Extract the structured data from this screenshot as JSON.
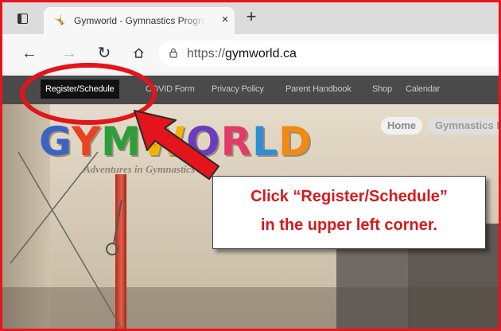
{
  "browser": {
    "tab": {
      "title": "Gymworld - Gymnastics Program",
      "close_glyph": "×"
    },
    "new_tab_glyph": "+",
    "nav": {
      "back_glyph": "←",
      "forward_glyph": "→",
      "reload_glyph": "↻"
    },
    "url": {
      "prefix": "https://",
      "host": "gymworld.ca"
    }
  },
  "site": {
    "nav_items": [
      {
        "label": "Register/Schedule",
        "active": true
      },
      {
        "label": "COVID Form"
      },
      {
        "label": "Privacy Policy"
      },
      {
        "label": "Parent Handbook"
      },
      {
        "label": "Shop"
      },
      {
        "label": "Calendar"
      }
    ],
    "logo_letters": [
      "G",
      "Y",
      "M",
      "W",
      "O",
      "R",
      "L",
      "D"
    ],
    "tagline": "Adventures in Gymnastics",
    "pills": {
      "home": "Home",
      "gymnastics": "Gymnastics Programs"
    }
  },
  "callout": {
    "line1": "Click “Register/Schedule”",
    "line2": "in the upper left corner."
  },
  "colors": {
    "annotation_red": "#e3141b",
    "frame_red": "#e8141c",
    "callout_text": "#d7191c",
    "site_nav_bg": "#4a4a4a",
    "active_nav_bg": "#111111"
  }
}
